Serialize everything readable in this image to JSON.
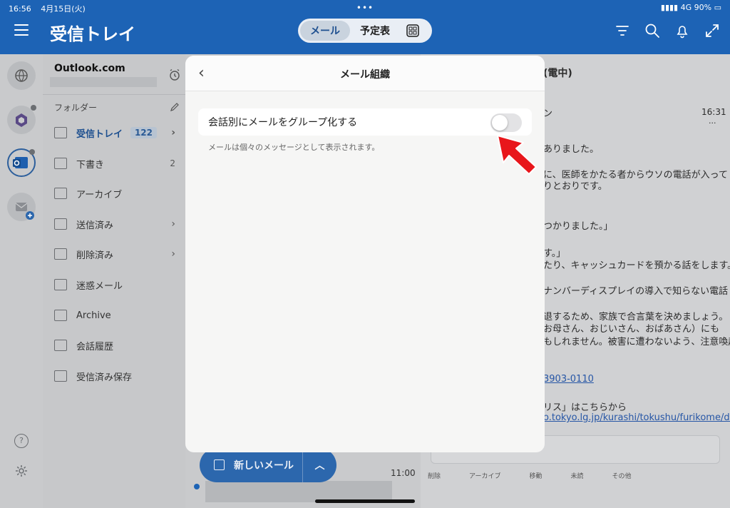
{
  "status": {
    "time": "16:56",
    "date": "4月15日(火)",
    "signal": "4G",
    "battery": "90%"
  },
  "header": {
    "title": "受信トレイ",
    "tabs": [
      {
        "label": "メール"
      },
      {
        "label": "予定表"
      }
    ]
  },
  "account": {
    "name": "Outlook.com"
  },
  "folders": {
    "section_label": "フォルダー",
    "items": [
      {
        "label": "受信トレイ",
        "count": "122"
      },
      {
        "label": "下書き",
        "count": "2"
      },
      {
        "label": "アーカイブ"
      },
      {
        "label": "送信済み"
      },
      {
        "label": "削除済み"
      },
      {
        "label": "迷惑メール"
      },
      {
        "label": "Archive"
      },
      {
        "label": "会話履歴"
      },
      {
        "label": "受信済み保存"
      }
    ]
  },
  "reading": {
    "subject_fragment": "(電中)",
    "sender_fragment": "ン",
    "time": "16:31",
    "more": "···",
    "lines": [
      "ありました。",
      "に、医師をかたる者からウソの電話が入って",
      "りとおりです。",
      "つかりました。」",
      "す。」",
      "たり、キャッシュカードを預かる話をします。",
      "ナンバーディスプレイの導入で知らない電話",
      "退するため、家族で合言葉を決めましょう。",
      "お母さん、おじいさん、おばあさん）にも",
      "もしれません。被害に遭わないよう、注意喚起",
      "リス」はこちらから"
    ],
    "phone_link": "3903-0110",
    "url_link": "o.tokyo.lg.jp/kurashi/tokushu/furikome/dig",
    "toolbar": [
      "削除",
      "アーカイブ",
      "移動",
      "未読",
      "その他"
    ]
  },
  "list": {
    "time": "11:00",
    "new_mail_label": "新しいメール"
  },
  "modal": {
    "title": "メール組織",
    "setting_label": "会話別にメールをグループ化する",
    "setting_hint": "メールは個々のメッセージとして表示されます。",
    "toggle_state": "off"
  },
  "colors": {
    "header": "#1d63b5",
    "arrow": "#e8161b"
  }
}
